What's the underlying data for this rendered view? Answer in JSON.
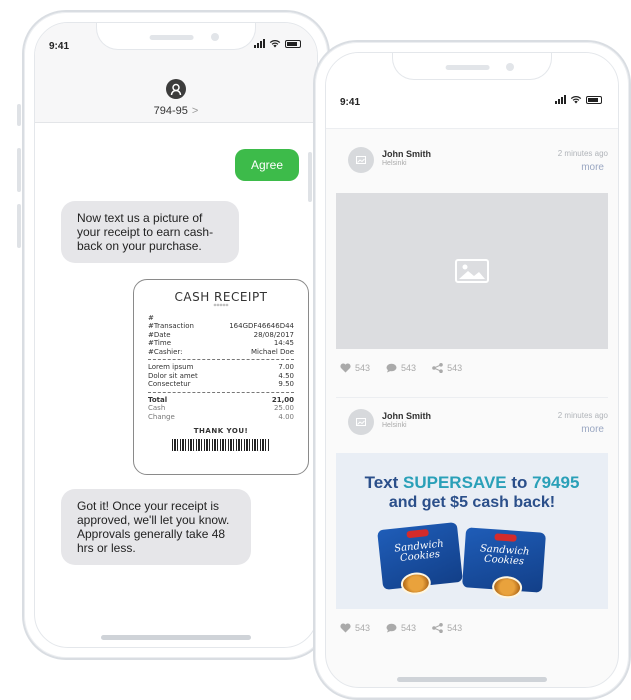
{
  "left_phone": {
    "status_time": "9:41",
    "contact": {
      "name": "794-95",
      "chevron": ">"
    },
    "messages": [
      {
        "direction": "out",
        "text": "Agree"
      },
      {
        "direction": "in",
        "text": "Now text us a picture of your receipt to earn cash-back on your purchase."
      },
      {
        "direction": "in",
        "text": "Got it! Once your receipt is approved, we'll let you know. Approvals generally take 48 hrs or less."
      }
    ],
    "receipt": {
      "title": "CASH RECEIPT",
      "stars": "*****",
      "hash": "#",
      "meta": [
        {
          "key": "#Transaction",
          "value": "164GDF46646D44"
        },
        {
          "key": "#Date",
          "value": "28/08/2017"
        },
        {
          "key": "#Time",
          "value": "14:45"
        },
        {
          "key": "#Cashier:",
          "value": "Michael Doe"
        }
      ],
      "items": [
        {
          "name": "Lorem ipsum",
          "price": "7.00"
        },
        {
          "name": "Dolor sit amet",
          "price": "4.50"
        },
        {
          "name": "Consectetur",
          "price": "9.50"
        }
      ],
      "total_label": "Total",
      "total_value": "21,00",
      "cash_label": "Cash",
      "cash_value": "25.00",
      "change_label": "Change",
      "change_value": "4.00",
      "thanks": "THANK YOU!"
    }
  },
  "right_phone": {
    "status_time": "9:41",
    "posts": [
      {
        "author": "John Smith",
        "location": "Helsinki",
        "time": "2 minutes ago",
        "more": "more",
        "likes": "543",
        "comments": "543",
        "shares": "543"
      },
      {
        "author": "John Smith",
        "location": "Helsinki",
        "time": "2 minutes ago",
        "more": "more",
        "likes": "543",
        "comments": "543",
        "shares": "543"
      }
    ],
    "promo": {
      "prefix": "Text ",
      "keyword": "SUPERSAVE",
      "middle": " to ",
      "number": "79495",
      "line2": "and get $5 cash back!",
      "product_name": "Sandwich Cookies"
    }
  },
  "colors": {
    "sent_bubble": "#3dbb4a",
    "received_bubble": "#e6e6e9",
    "promo_blue": "#2b4f8a",
    "promo_teal": "#2aa0b8"
  }
}
